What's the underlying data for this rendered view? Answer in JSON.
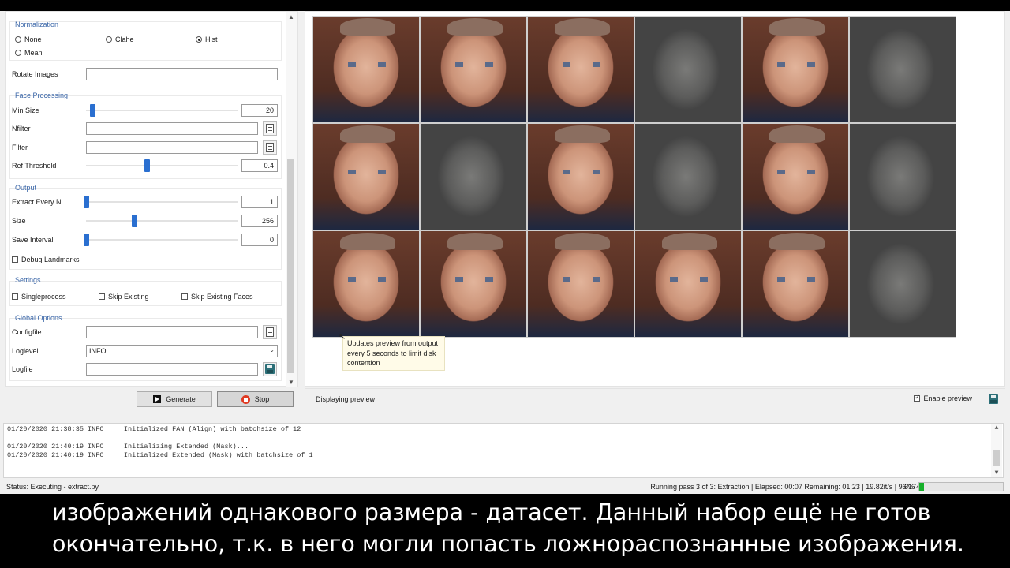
{
  "options": {
    "normalization": {
      "title": "Normalization",
      "options": [
        "None",
        "Clahe",
        "Hist",
        "Mean"
      ],
      "selected": "Hist"
    },
    "rotate_images": {
      "label": "Rotate Images",
      "value": ""
    },
    "face_processing": {
      "title": "Face Processing",
      "min_size": {
        "label": "Min Size",
        "value": "20",
        "level": 0.04
      },
      "nfilter": {
        "label": "Nfilter",
        "value": ""
      },
      "filter": {
        "label": "Filter",
        "value": ""
      },
      "ref_threshold": {
        "label": "Ref Threshold",
        "value": "0.4",
        "level": 0.4
      }
    },
    "output": {
      "title": "Output",
      "extract_every_n": {
        "label": "Extract Every N",
        "value": "1",
        "level": 0.0
      },
      "size": {
        "label": "Size",
        "value": "256",
        "level": 0.32
      },
      "save_interval": {
        "label": "Save Interval",
        "value": "0",
        "level": 0.0
      },
      "debug_landmarks": {
        "label": "Debug Landmarks",
        "checked": false
      }
    },
    "settings": {
      "title": "Settings",
      "singleprocess": {
        "label": "Singleprocess",
        "checked": false
      },
      "skip_existing": {
        "label": "Skip Existing",
        "checked": false
      },
      "skip_existing_faces": {
        "label": "Skip Existing Faces",
        "checked": false
      }
    },
    "global_options": {
      "title": "Global Options",
      "configfile": {
        "label": "Configfile",
        "value": ""
      },
      "loglevel": {
        "label": "Loglevel",
        "value": "INFO"
      },
      "logfile": {
        "label": "Logfile",
        "value": ""
      }
    }
  },
  "buttons": {
    "generate": "Generate",
    "stop": "Stop"
  },
  "preview": {
    "faces": [
      "color",
      "color",
      "color",
      "gray",
      "color",
      "gray",
      "color",
      "gray",
      "color",
      "gray",
      "color",
      "gray",
      "color",
      "color",
      "color",
      "color",
      "color",
      "gray"
    ],
    "tooltip": "Updates preview from output every 5 seconds to limit disk contention",
    "status": "Displaying preview",
    "enable_preview": {
      "label": "Enable preview",
      "checked": true
    }
  },
  "log": [
    "01/20/2020 21:38:35 INFO     Initialized FAN (Align) with batchsize of 12",
    "",
    "01/20/2020 21:40:19 INFO     Initializing Extended (Mask)...",
    "01/20/2020 21:40:19 INFO     Initialized Extended (Mask) with batchsize of 1"
  ],
  "status": {
    "left": "Status:   Executing - extract.py",
    "right": "Running pass 3 of 3: Extraction  |  Elapsed: 00:07  Remaining: 01:23  |  19.82it/s  |  96/1743  |",
    "percent_text": "6%",
    "progress": 0.06
  },
  "subtitles": [
    "изображений однакового размера - датасет. Данный набор ещё не готов",
    "окончательно, т.к. в него могли попасть ложнораспознанные изображения."
  ],
  "colors": {
    "accent": "#2a6fd0",
    "group_title": "#3a66a8",
    "progress": "#16b02a",
    "stop": "#e03a22"
  }
}
